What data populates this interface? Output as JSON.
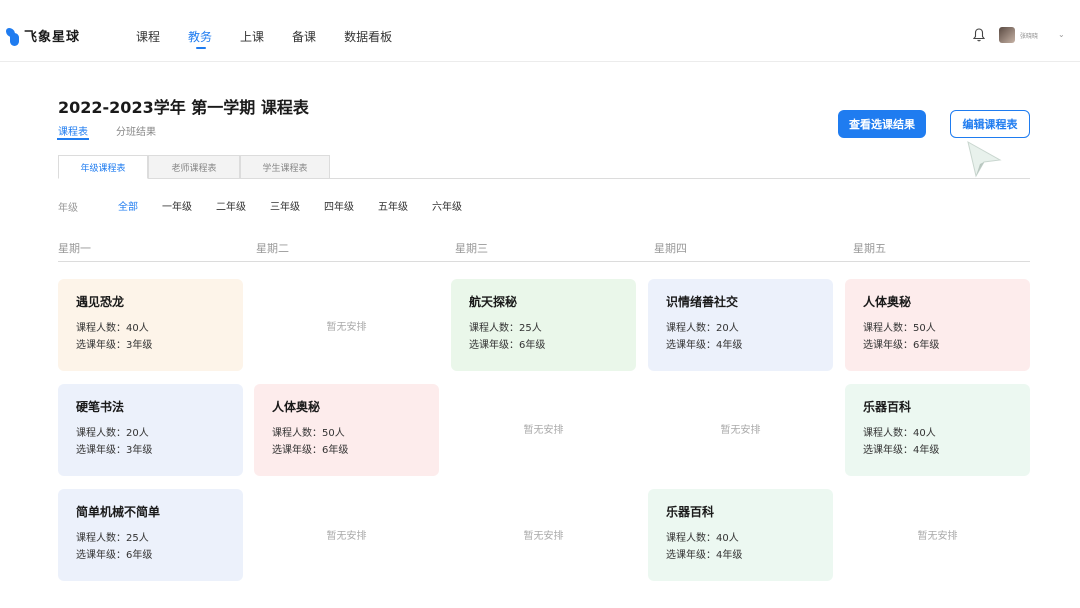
{
  "app": {
    "name": "飞象星球"
  },
  "nav": [
    {
      "label": "课程"
    },
    {
      "label": "教务"
    },
    {
      "label": "上课"
    },
    {
      "label": "备课"
    },
    {
      "label": "数据看板"
    }
  ],
  "user": {
    "name": "张晓晓"
  },
  "page": {
    "title": "2022-2023学年 第一学期 课程表",
    "subtabs": [
      "课程表",
      "分班结果"
    ],
    "btn_view": "查看选课结果",
    "btn_edit": "编辑课程表",
    "seg_tabs": [
      "年级课程表",
      "老师课程表",
      "学生课程表"
    ]
  },
  "filter": {
    "label": "年级",
    "grades": [
      "全部",
      "一年级",
      "二年级",
      "三年级",
      "四年级",
      "五年级",
      "六年级"
    ]
  },
  "days": [
    "星期一",
    "星期二",
    "星期三",
    "星期四",
    "星期五"
  ],
  "empty_text": "暂无安排",
  "cards": [
    {
      "title": "遇见恐龙",
      "count": "课程人数：40人",
      "grade": "选课年级：3年级"
    },
    {
      "title": "航天探秘",
      "count": "课程人数：25人",
      "grade": "选课年级：6年级"
    },
    {
      "title": "识情绪善社交",
      "count": "课程人数：20人",
      "grade": "选课年级：4年级"
    },
    {
      "title": "人体奥秘",
      "count": "课程人数：50人",
      "grade": "选课年级：6年级"
    },
    {
      "title": "硬笔书法",
      "count": "课程人数：20人",
      "grade": "选课年级：3年级"
    },
    {
      "title": "人体奥秘",
      "count": "课程人数：50人",
      "grade": "选课年级：6年级"
    },
    {
      "title": "乐器百科",
      "count": "课程人数：40人",
      "grade": "选课年级：4年级"
    },
    {
      "title": "简单机械不简单",
      "count": "课程人数：25人",
      "grade": "选课年级：6年级"
    },
    {
      "title": "乐器百科",
      "count": "课程人数：40人",
      "grade": "选课年级：4年级"
    }
  ],
  "colors": {
    "accent": "#1f7cf0"
  }
}
